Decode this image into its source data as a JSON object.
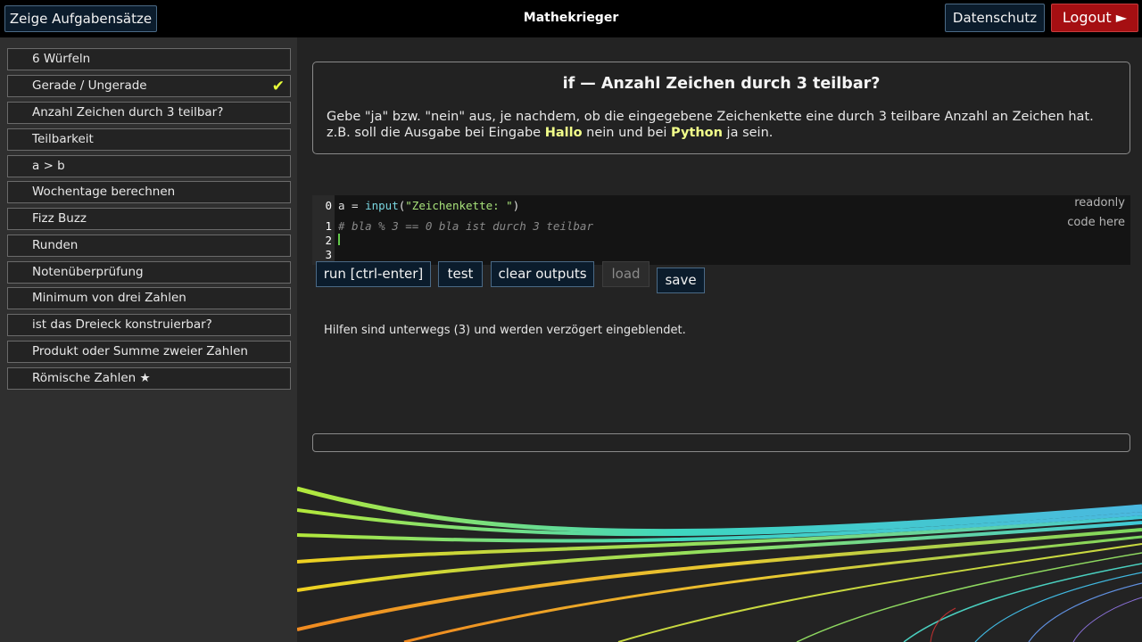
{
  "header": {
    "sets_button": "Zeige Aufgabensätze",
    "title": "Mathekrieger",
    "privacy_button": "Datenschutz",
    "logout_button": "Logout ►"
  },
  "sidebar": {
    "items": [
      {
        "label": "6 Würfeln",
        "done": false
      },
      {
        "label": "Gerade / Ungerade",
        "done": true
      },
      {
        "label": "Anzahl Zeichen durch 3 teilbar?",
        "done": false
      },
      {
        "label": "Teilbarkeit",
        "done": false
      },
      {
        "label": "a > b",
        "done": false
      },
      {
        "label": "Wochentage berechnen",
        "done": false
      },
      {
        "label": "Fizz Buzz",
        "done": false
      },
      {
        "label": "Runden",
        "done": false
      },
      {
        "label": "Notenüberprüfung",
        "done": false
      },
      {
        "label": "Minimum von drei Zahlen",
        "done": false
      },
      {
        "label": "ist das Dreieck konstruierbar?",
        "done": false
      },
      {
        "label": "Produkt oder Summe zweier Zahlen",
        "done": false
      },
      {
        "label": "Römische Zahlen ★",
        "done": false
      }
    ],
    "check_mark": "✔"
  },
  "task": {
    "title": "if — Anzahl Zeichen durch 3 teilbar?",
    "desc_line1": "Gebe \"ja\" bzw. \"nein\" aus, je nachdem, ob die eingegebene Zeichenkette eine durch 3 teilbare Anzahl an Zeichen hat.",
    "desc_prefix": "z.B. soll die Ausgabe bei Eingabe ",
    "example1": "Hallo",
    "desc_middle": " nein und bei ",
    "example2": "Python",
    "desc_suffix": " ja sein."
  },
  "editor": {
    "line_numbers": [
      "0",
      "1",
      "2",
      "3"
    ],
    "readonly_line": {
      "var": "a",
      "op": " = ",
      "func": "input",
      "open": "(",
      "str": "\"Zeichenkette: \"",
      "close": ")"
    },
    "comment_line": "# bla % 3 == 0 bla ist durch 3 teilbar",
    "readonly_label": "readonly",
    "code_here_label": "code here"
  },
  "toolbar": {
    "run": "run [ctrl-enter]",
    "test": "test",
    "clear": "clear outputs",
    "load": "load",
    "save": "save"
  },
  "hint": "Hilfen sind unterwegs (3) und werden verzögert eingeblendet.",
  "colors": {
    "background": "#232323",
    "sidebar": "#2f2f2f",
    "button": "#0b1c2c",
    "logout": "#a50f12",
    "highlight": "#f2ff8a"
  }
}
